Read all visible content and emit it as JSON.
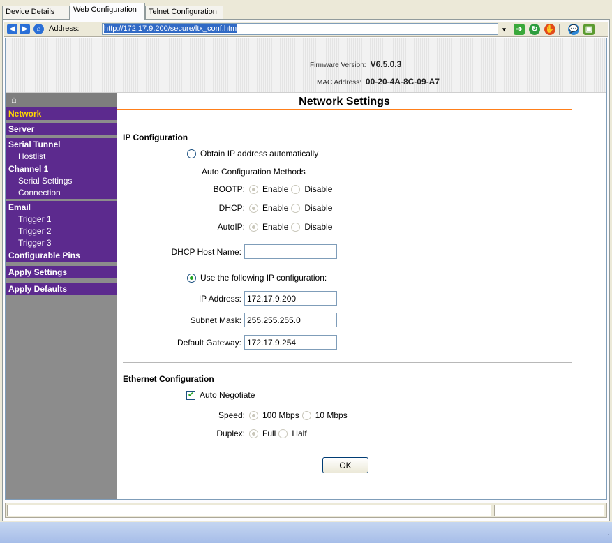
{
  "tabs": [
    {
      "label": "Device Details"
    },
    {
      "label": "Web Configuration"
    },
    {
      "label": "Telnet Configuration"
    }
  ],
  "address": {
    "label": "Address:",
    "url": "http://172.17.9.200/secure/ltx_conf.htm"
  },
  "header": {
    "firmware_label": "Firmware Version:",
    "firmware_value": "V6.5.0.3",
    "mac_label": "MAC Address:",
    "mac_value": "00-20-4A-8C-09-A7"
  },
  "sidebar": {
    "home_icon": "home-icon",
    "items": [
      {
        "label": "Network"
      },
      {
        "label": "Server"
      },
      {
        "label": "Serial Tunnel"
      },
      {
        "label": "Hostlist"
      },
      {
        "label": "Channel 1"
      },
      {
        "label": "Serial Settings"
      },
      {
        "label": "Connection"
      },
      {
        "label": "Email"
      },
      {
        "label": "Trigger 1"
      },
      {
        "label": "Trigger 2"
      },
      {
        "label": "Trigger 3"
      },
      {
        "label": "Configurable Pins"
      },
      {
        "label": "Apply Settings"
      },
      {
        "label": "Apply Defaults"
      }
    ]
  },
  "main": {
    "title": "Network Settings",
    "ip_section": "IP Configuration",
    "obtain_auto": "Obtain IP address automatically",
    "auto_methods": "Auto Configuration Methods",
    "bootp": "BOOTP:",
    "dhcp": "DHCP:",
    "autoip": "AutoIP:",
    "enable": "Enable",
    "disable": "Disable",
    "dhcp_host_label": "DHCP Host Name:",
    "dhcp_host_value": "",
    "use_following": "Use the following IP configuration:",
    "ip_label": "IP Address:",
    "ip_value": "172.17.9.200",
    "subnet_label": "Subnet Mask:",
    "subnet_value": "255.255.255.0",
    "gateway_label": "Default Gateway:",
    "gateway_value": "172.17.9.254",
    "eth_section": "Ethernet Configuration",
    "auto_negotiate": "Auto Negotiate",
    "speed_label": "Speed:",
    "speed_100": "100 Mbps",
    "speed_10": "10 Mbps",
    "duplex_label": "Duplex:",
    "duplex_full": "Full",
    "duplex_half": "Half",
    "ok": "OK"
  },
  "colors": {
    "nav_bg": "#5c2a8e",
    "nav_active_text": "#ffd700",
    "title_rule": "#ff7f1a",
    "sidebar_bg": "#8c8c8c"
  }
}
